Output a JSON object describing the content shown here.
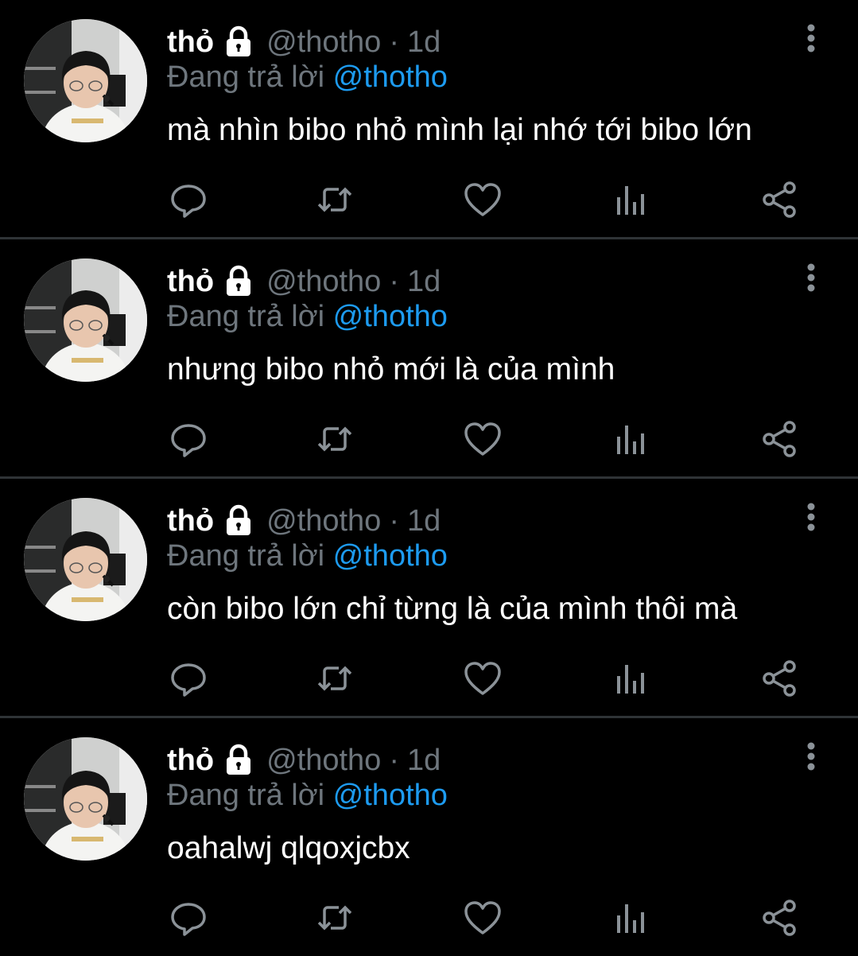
{
  "tweets": [
    {
      "display_name": "thỏ",
      "handle": "@thotho",
      "separator": "·",
      "time": "1d",
      "replying_prefix": "Đang trả lời",
      "replying_to": "@thotho",
      "text": "mà nhìn bibo nhỏ mình lại nhớ tới bibo lớn"
    },
    {
      "display_name": "thỏ",
      "handle": "@thotho",
      "separator": "·",
      "time": "1d",
      "replying_prefix": "Đang trả lời",
      "replying_to": "@thotho",
      "text": "nhưng bibo nhỏ mới là của mình"
    },
    {
      "display_name": "thỏ",
      "handle": "@thotho",
      "separator": "·",
      "time": "1d",
      "replying_prefix": "Đang trả lời",
      "replying_to": "@thotho",
      "text": "còn bibo lớn chỉ từng là của mình thôi mà"
    },
    {
      "display_name": "thỏ",
      "handle": "@thotho",
      "separator": "·",
      "time": "1d",
      "replying_prefix": "Đang trả lời",
      "replying_to": "@thotho",
      "text": "oahalwj qlqoxjcbx"
    }
  ],
  "icons": {
    "lock": "lock-icon",
    "more": "more-vertical-icon",
    "reply": "reply-icon",
    "retweet": "retweet-icon",
    "like": "heart-icon",
    "views": "analytics-icon",
    "share": "share-icon"
  },
  "colors": {
    "background": "#000000",
    "text": "#ffffff",
    "muted": "#6e767d",
    "accent": "#1d9bf0",
    "divider": "#2f3336"
  }
}
